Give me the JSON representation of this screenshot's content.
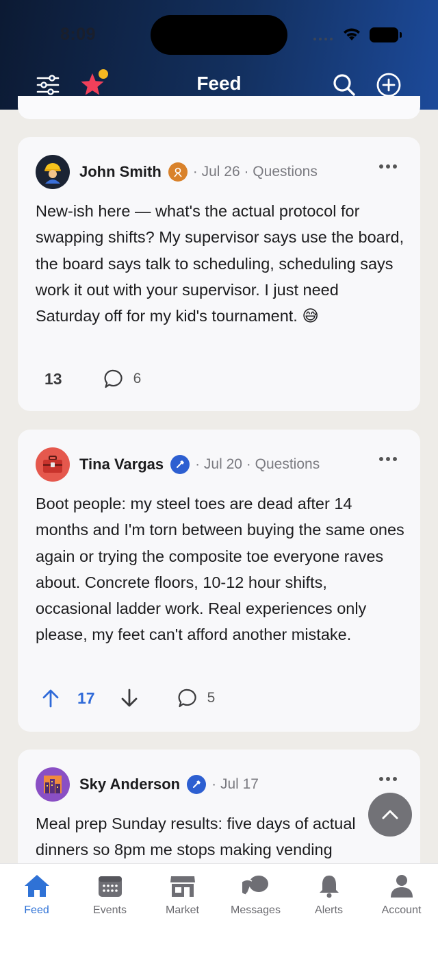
{
  "status_bar": {
    "time": "8:09"
  },
  "header": {
    "title": "Feed",
    "icons": [
      "filter-icon",
      "star-icon",
      "search-icon",
      "add-icon"
    ],
    "accent": "#1c4a9a"
  },
  "posts": [
    {
      "author": "John Smith",
      "avatar_icon": "construction-worker-icon",
      "badge_icon": "user-badge-icon",
      "meta": "· Jul 26 · Questions",
      "body": "New-ish here — what's the actual protocol for swapping shifts? My supervisor says use the board, the board says talk to scheduling, scheduling says work it out with your supervisor. I just need Saturday off for my kid's tournament. 😅",
      "score": "13",
      "comments": "6"
    },
    {
      "author": "Tina Vargas",
      "avatar_icon": "toolbox-icon",
      "badge_icon": "hammer-badge-icon",
      "meta": "· Jul 20 · Questions",
      "body": "Boot people: my steel toes are dead after 14 months and I'm torn between buying the same ones again or trying the composite toe everyone raves about. Concrete floors, 10-12 hour shifts, occasional ladder work. Real experiences only please, my feet can't afford another mistake.",
      "score": "17",
      "comments": "5"
    },
    {
      "author": "Sky Anderson",
      "avatar_icon": "city-skyline-icon",
      "badge_icon": "hammer-badge-icon",
      "meta": "· Jul 17",
      "body": "Meal prep Sunday results: five days of actual dinners so 8pm me stops making vending"
    }
  ],
  "tabbar": {
    "items": [
      {
        "label": "Feed",
        "icon": "home-icon",
        "active": true
      },
      {
        "label": "Events",
        "icon": "calendar-icon"
      },
      {
        "label": "Market",
        "icon": "storefront-icon"
      },
      {
        "label": "Messages",
        "icon": "chat-bubbles-icon"
      },
      {
        "label": "Alerts",
        "icon": "bell-icon"
      },
      {
        "label": "Account",
        "icon": "person-icon"
      }
    ],
    "active_color": "#2f72d6"
  }
}
